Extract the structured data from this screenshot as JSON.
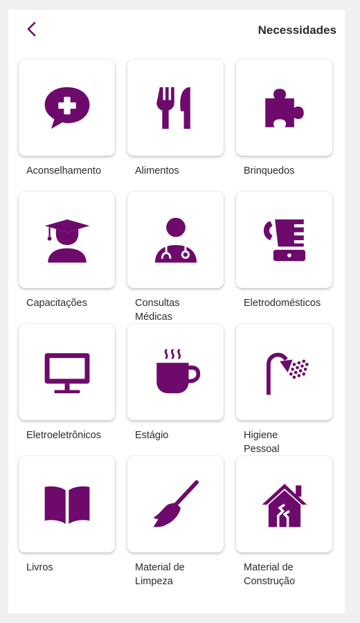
{
  "header": {
    "title": "Necessidades",
    "back_icon": "chevron-left-icon"
  },
  "theme": {
    "accent": "#6d0a6b"
  },
  "items": [
    {
      "label": "Aconselhamento",
      "icon": "chat-plus-icon"
    },
    {
      "label": "Alimentos",
      "icon": "fork-knife-icon"
    },
    {
      "label": "Brinquedos",
      "icon": "puzzle-icon"
    },
    {
      "label": "Capacitações",
      "icon": "graduate-icon"
    },
    {
      "label": "Consultas\nMédicas",
      "icon": "doctor-icon"
    },
    {
      "label": "Eletrodomésticos",
      "icon": "blender-icon"
    },
    {
      "label": "Eletroeletrônicos",
      "icon": "monitor-icon"
    },
    {
      "label": "Estágio",
      "icon": "coffee-cup-icon"
    },
    {
      "label": "Higiene\nPessoal",
      "icon": "shower-icon"
    },
    {
      "label": "Livros",
      "icon": "book-icon"
    },
    {
      "label": "Material de\nLimpeza",
      "icon": "broom-icon"
    },
    {
      "label": "Material de\nConstrução",
      "icon": "house-icon"
    }
  ]
}
